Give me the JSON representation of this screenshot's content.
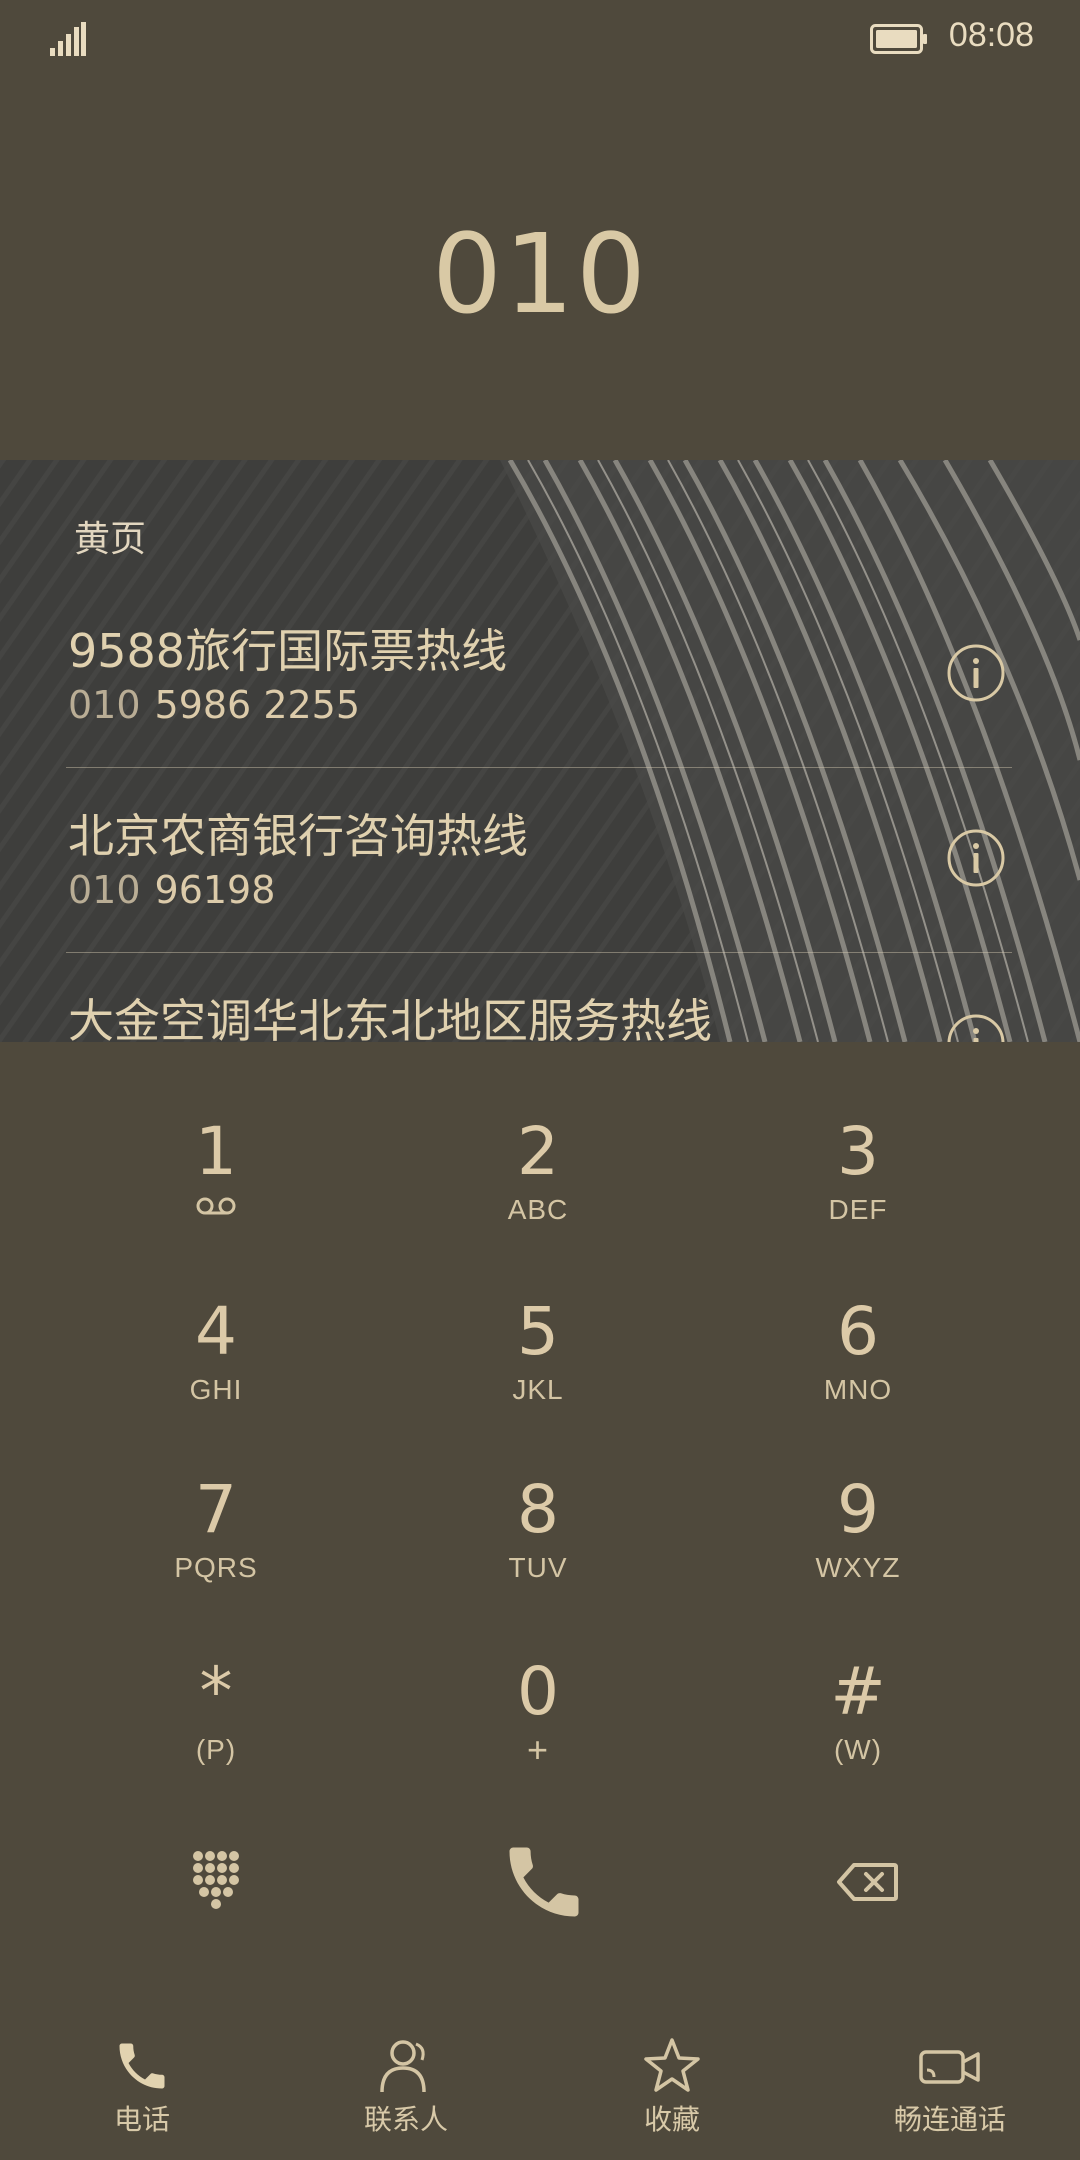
{
  "status_bar": {
    "time": "08:08",
    "signal_icon": "signal-bars-icon",
    "battery_icon": "battery-icon"
  },
  "dialer": {
    "input_number": "010"
  },
  "results": {
    "section_title": "黄页",
    "items": [
      {
        "name": "9588旅行国际票热线",
        "number_match": "010",
        "number_rest": "5986 2255",
        "icon": "info-icon"
      },
      {
        "name": "北京农商银行咨询热线",
        "number_match": "010",
        "number_rest": "96198",
        "icon": "info-icon"
      },
      {
        "name": "大金空调华北东北地区服务热线",
        "icon": "info-icon"
      }
    ]
  },
  "keypad": {
    "keys": [
      {
        "digit": "1",
        "letters": "",
        "icon": "voicemail-icon"
      },
      {
        "digit": "2",
        "letters": "ABC"
      },
      {
        "digit": "3",
        "letters": "DEF"
      },
      {
        "digit": "4",
        "letters": "GHI"
      },
      {
        "digit": "5",
        "letters": "JKL"
      },
      {
        "digit": "6",
        "letters": "MNO"
      },
      {
        "digit": "7",
        "letters": "PQRS"
      },
      {
        "digit": "8",
        "letters": "TUV"
      },
      {
        "digit": "9",
        "letters": "WXYZ"
      },
      {
        "digit": "*",
        "letters": "(P)"
      },
      {
        "digit": "0",
        "letters": "+"
      },
      {
        "digit": "#",
        "letters": "(W)"
      }
    ],
    "actions": {
      "dialpad_toggle_icon": "dialpad-grid-icon",
      "call_icon": "phone-icon",
      "backspace_icon": "backspace-icon"
    }
  },
  "bottom_nav": {
    "items": [
      {
        "label": "电话",
        "icon": "phone-icon"
      },
      {
        "label": "联系人",
        "icon": "contacts-icon"
      },
      {
        "label": "收藏",
        "icon": "star-icon"
      },
      {
        "label": "畅连通话",
        "icon": "video-call-icon"
      }
    ]
  },
  "colors": {
    "background": "#4f493c",
    "accent": "#d9c9a5",
    "panel": "#3b3b3a"
  }
}
